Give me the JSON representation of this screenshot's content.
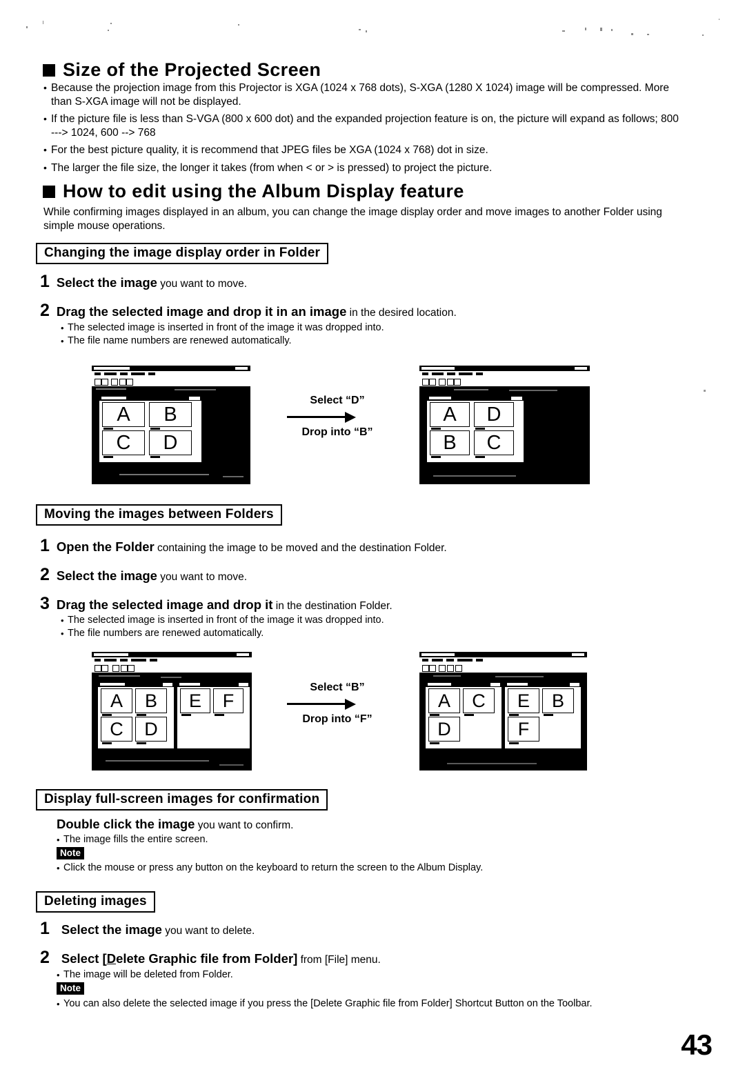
{
  "page": {
    "number": "43"
  },
  "section1": {
    "heading": "Size of the Projected Screen",
    "bullets": [
      "Because the projection image from this Projector is XGA (1024 x 768 dots), S-XGA (1280 X 1024) image will be compressed. More than S-XGA image will not be displayed.",
      "If the picture file is less than S-VGA (800 x 600 dot) and the expanded projection feature is on, the picture will expand as follows; 800 ---> 1024, 600 --> 768",
      "For the best picture quality, it is recommend that JPEG files be XGA (1024 x 768) dot in size.",
      "The larger the file size, the longer it takes (from when < or > is pressed) to project the picture."
    ]
  },
  "section2": {
    "heading": "How to edit using the Album Display feature",
    "intro": "While confirming images displayed in an album, you can change the image display order and move images to another Folder using simple mouse operations.",
    "sub1": {
      "title": "Changing the image display order in Folder",
      "steps": [
        {
          "num": "1",
          "bold": "Select the image",
          "normal": " you want to move."
        },
        {
          "num": "2",
          "bold": "Drag the selected image and drop it in an image",
          "normal": " in the desired location."
        }
      ],
      "notes": [
        "The selected image is inserted in front of the image it was dropped into.",
        "The file name numbers are renewed automatically."
      ],
      "figure": {
        "before": {
          "windows": [
            {
              "thumbs": [
                "A",
                "B",
                "C",
                "D"
              ],
              "cols": 2
            }
          ]
        },
        "annotation": {
          "top": "Select “D”",
          "bottom": "Drop into “B”"
        },
        "after": {
          "windows": [
            {
              "thumbs": [
                "A",
                "D",
                "B",
                "C"
              ],
              "cols": 2
            }
          ]
        }
      }
    },
    "sub2": {
      "title": "Moving the images between Folders",
      "steps": [
        {
          "num": "1",
          "bold": "Open the Folder",
          "normal": " containing the image to be moved and the destination Folder."
        },
        {
          "num": "2",
          "bold": "Select the image",
          "normal": " you want to move."
        },
        {
          "num": "3",
          "bold": "Drag the selected image and drop it",
          "normal": " in the destination Folder."
        }
      ],
      "notes": [
        "The selected image is inserted in front of the image it was dropped into.",
        "The file numbers are renewed automatically."
      ],
      "figure": {
        "before": {
          "windows": [
            {
              "thumbs": [
                "A",
                "B",
                "C",
                "D"
              ],
              "cols": 2
            },
            {
              "thumbs": [
                "E",
                "F"
              ],
              "cols": 2
            }
          ]
        },
        "annotation": {
          "top": "Select “B”",
          "bottom": "Drop into “F”"
        },
        "after": {
          "windows": [
            {
              "thumbs": [
                "A",
                "C",
                "D"
              ],
              "cols": 2
            },
            {
              "thumbs": [
                "E",
                "B",
                "F"
              ],
              "cols": 2
            }
          ]
        }
      }
    },
    "sub3": {
      "title": "Display full-screen images for confirmation",
      "lead_bold": "Double click the image",
      "lead_normal": " you want to confirm.",
      "notes": [
        "The image fills the entire screen."
      ],
      "note_label": "Note",
      "note_items": [
        "Click the mouse or press any button on the keyboard to return the screen to the Album Display."
      ]
    },
    "sub4": {
      "title": "Deleting images",
      "steps": [
        {
          "num": "1",
          "bold": "Select the image",
          "normal": " you want to delete."
        }
      ],
      "step2": {
        "num": "2",
        "prefix": "Select [",
        "mnemonic": "D",
        "bold_rest": "elete Graphic file from Folder]",
        "normal": " from [File] menu."
      },
      "notes": [
        "The image will be deleted from Folder."
      ],
      "note_label": "Note",
      "note_items": [
        "You can also delete the selected image if you press the [Delete Graphic file from Folder] Shortcut Button on the Toolbar."
      ]
    }
  }
}
